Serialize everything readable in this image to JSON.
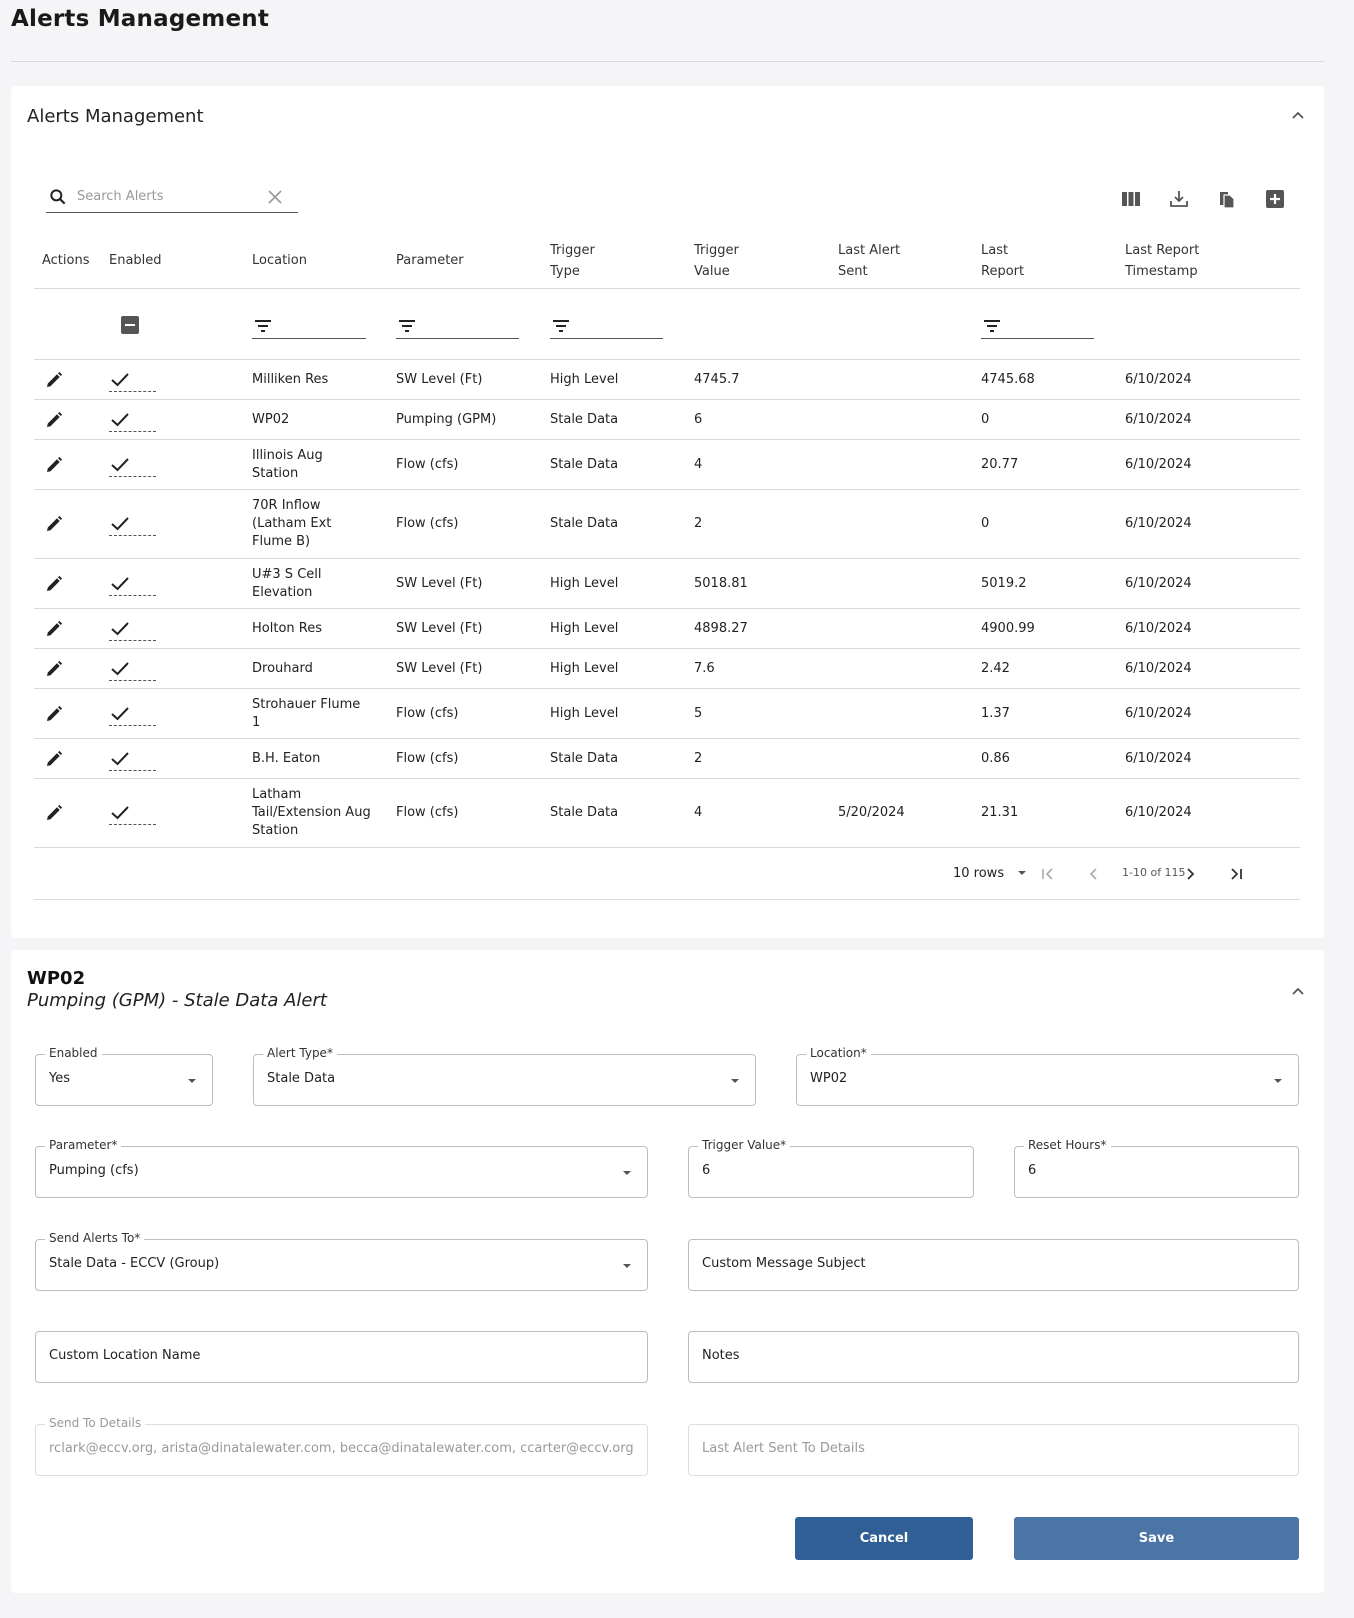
{
  "page": {
    "title": "Alerts Management"
  },
  "alerts_card": {
    "title": "Alerts Management",
    "search": {
      "placeholder": "Search Alerts",
      "value": ""
    },
    "toolbar": [
      "columns-icon",
      "download-icon",
      "copy-icon",
      "add-icon"
    ],
    "columns": [
      "Actions",
      "Enabled",
      "Location",
      "Parameter",
      "Trigger Type",
      "Trigger Value",
      "Last Alert Sent",
      "Last Report",
      "Last Report Timestamp"
    ],
    "rows": [
      {
        "location": "Milliken Res",
        "parameter": "SW Level (Ft)",
        "trigger_type": "High Level",
        "trigger_value": "4745.7",
        "last_alert_sent": "",
        "last_report": "4745.68",
        "timestamp": "6/10/2024",
        "enabled": true
      },
      {
        "location": "WP02",
        "parameter": "Pumping (GPM)",
        "trigger_type": "Stale Data",
        "trigger_value": "6",
        "last_alert_sent": "",
        "last_report": "0",
        "timestamp": "6/10/2024",
        "enabled": true
      },
      {
        "location": "Illinois Aug Station",
        "parameter": "Flow (cfs)",
        "trigger_type": "Stale Data",
        "trigger_value": "4",
        "last_alert_sent": "",
        "last_report": "20.77",
        "timestamp": "6/10/2024",
        "enabled": true
      },
      {
        "location": "70R Inflow (Latham Ext Flume B)",
        "parameter": "Flow (cfs)",
        "trigger_type": "Stale Data",
        "trigger_value": "2",
        "last_alert_sent": "",
        "last_report": "0",
        "timestamp": "6/10/2024",
        "enabled": true
      },
      {
        "location": "U#3 S Cell Elevation",
        "parameter": "SW Level (Ft)",
        "trigger_type": "High Level",
        "trigger_value": "5018.81",
        "last_alert_sent": "",
        "last_report": "5019.2",
        "timestamp": "6/10/2024",
        "enabled": true
      },
      {
        "location": "Holton Res",
        "parameter": "SW Level (Ft)",
        "trigger_type": "High Level",
        "trigger_value": "4898.27",
        "last_alert_sent": "",
        "last_report": "4900.99",
        "timestamp": "6/10/2024",
        "enabled": true
      },
      {
        "location": "Drouhard",
        "parameter": "SW Level (Ft)",
        "trigger_type": "High Level",
        "trigger_value": "7.6",
        "last_alert_sent": "",
        "last_report": "2.42",
        "timestamp": "6/10/2024",
        "enabled": true
      },
      {
        "location": "Strohauer Flume 1",
        "parameter": "Flow (cfs)",
        "trigger_type": "High Level",
        "trigger_value": "5",
        "last_alert_sent": "",
        "last_report": "1.37",
        "timestamp": "6/10/2024",
        "enabled": true
      },
      {
        "location": "B.H. Eaton",
        "parameter": "Flow (cfs)",
        "trigger_type": "Stale Data",
        "trigger_value": "2",
        "last_alert_sent": "",
        "last_report": "0.86",
        "timestamp": "6/10/2024",
        "enabled": true
      },
      {
        "location": "Latham Tail/Extension Aug Station",
        "parameter": "Flow (cfs)",
        "trigger_type": "Stale Data",
        "trigger_value": "4",
        "last_alert_sent": "5/20/2024",
        "last_report": "21.31",
        "timestamp": "6/10/2024",
        "enabled": true
      }
    ],
    "pager": {
      "rows_label": "10 rows",
      "range": "1-10 of 115"
    }
  },
  "detail_card": {
    "title": "WP02",
    "subtitle": "Pumping (GPM) - Stale Data Alert",
    "fields": {
      "enabled": {
        "label": "Enabled",
        "value": "Yes"
      },
      "alert_type": {
        "label": "Alert Type*",
        "value": "Stale Data"
      },
      "location": {
        "label": "Location*",
        "value": "WP02"
      },
      "parameter": {
        "label": "Parameter*",
        "value": "Pumping (cfs)"
      },
      "trigger_value": {
        "label": "Trigger Value*",
        "value": "6"
      },
      "reset_hours": {
        "label": "Reset Hours*",
        "value": "6"
      },
      "send_alerts_to": {
        "label": "Send Alerts To*",
        "value": "Stale Data - ECCV (Group)"
      },
      "custom_subject": {
        "placeholder": "Custom Message Subject"
      },
      "custom_location": {
        "placeholder": "Custom Location Name"
      },
      "notes": {
        "placeholder": "Notes"
      },
      "send_to_details": {
        "label": "Send To Details",
        "value": "rclark@eccv.org, arista@dinatalewater.com, becca@dinatalewater.com, ccarter@eccv.org"
      },
      "last_alert_details": {
        "placeholder": "Last Alert Sent To Details"
      }
    },
    "buttons": {
      "cancel": "Cancel",
      "save": "Save"
    },
    "colors": {
      "cancel": "#2f5f95",
      "save": "#4a75a6"
    }
  }
}
